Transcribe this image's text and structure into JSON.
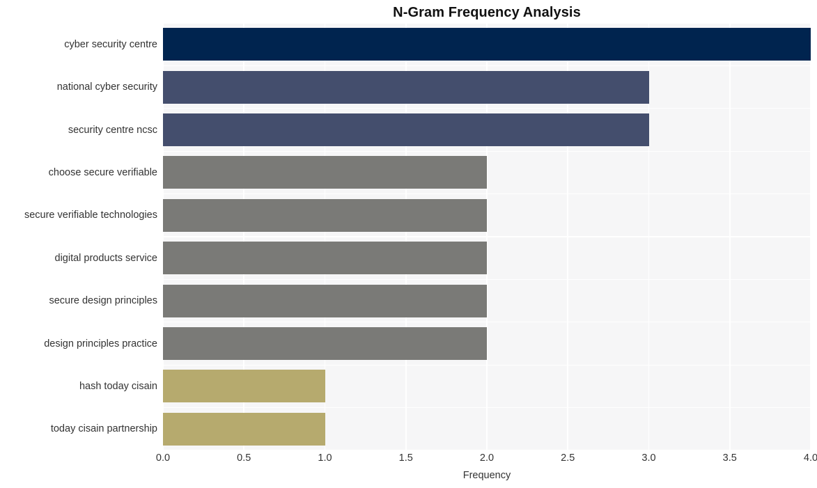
{
  "chart_data": {
    "type": "bar",
    "orientation": "horizontal",
    "title": "N-Gram Frequency Analysis",
    "xlabel": "Frequency",
    "ylabel": "",
    "categories": [
      "cyber security centre",
      "national cyber security",
      "security centre ncsc",
      "choose secure verifiable",
      "secure verifiable technologies",
      "digital products service",
      "secure design principles",
      "design principles practice",
      "hash today cisain",
      "today cisain partnership"
    ],
    "values": [
      4,
      3,
      3,
      2,
      2,
      2,
      2,
      2,
      1,
      1
    ],
    "bar_colors": [
      "#00244f",
      "#444e6d",
      "#444e6d",
      "#7a7a77",
      "#7a7a77",
      "#7a7a77",
      "#7a7a77",
      "#7a7a77",
      "#b6aa6e",
      "#b6aa6e"
    ],
    "xlim": [
      0,
      4
    ],
    "x_ticks": [
      0,
      0.5,
      1,
      1.5,
      2,
      2.5,
      3,
      3.5,
      4
    ],
    "x_tick_labels": [
      "0.0",
      "0.5",
      "1.0",
      "1.5",
      "2.0",
      "2.5",
      "3.0",
      "3.5",
      "4.0"
    ],
    "grid": true,
    "grid_color": "#ffffff",
    "plot_background": "#f6f6f7",
    "figure_background": "#ffffff",
    "legend": null,
    "legend_position": "none"
  }
}
